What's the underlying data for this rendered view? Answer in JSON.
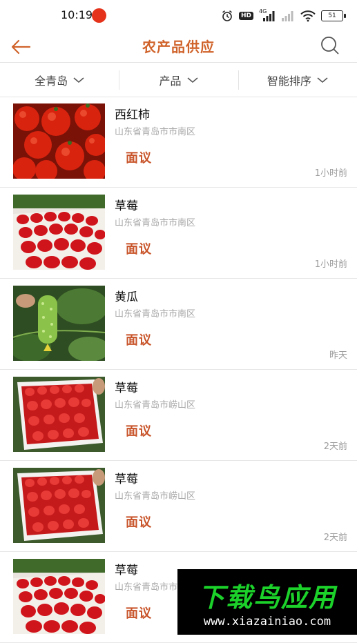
{
  "status_bar": {
    "time": "10:19",
    "icons": [
      "alarm-icon",
      "hd-icon",
      "cellular-4g-icon",
      "cellular-icon",
      "wifi-icon",
      "battery-icon"
    ],
    "hd": "HD",
    "network": "4G",
    "battery": "51"
  },
  "header": {
    "title": "农产品供应",
    "accent_color": "#d0632b"
  },
  "filters": [
    {
      "label": "全青岛"
    },
    {
      "label": "产品"
    },
    {
      "label": "智能排序"
    }
  ],
  "listings": [
    {
      "name": "西红柿",
      "location": "山东省青岛市市南区",
      "price": "面议",
      "time": "1小时前",
      "image": "tomato"
    },
    {
      "name": "草莓",
      "location": "山东省青岛市市南区",
      "price": "面议",
      "time": "1小时前",
      "image": "strawberry-field"
    },
    {
      "name": "黄瓜",
      "location": "山东省青岛市市南区",
      "price": "面议",
      "time": "昨天",
      "image": "cucumber"
    },
    {
      "name": "草莓",
      "location": "山东省青岛市崂山区",
      "price": "面议",
      "time": "2天前",
      "image": "strawberry-box"
    },
    {
      "name": "草莓",
      "location": "山东省青岛市崂山区",
      "price": "面议",
      "time": "2天前",
      "image": "strawberry-box"
    },
    {
      "name": "草莓",
      "location": "山东省青岛市市南区",
      "price": "面议",
      "time": "",
      "image": "strawberry-field"
    }
  ],
  "watermark": {
    "title": "下载鸟应用",
    "url": "www.xiazainiao.com"
  }
}
